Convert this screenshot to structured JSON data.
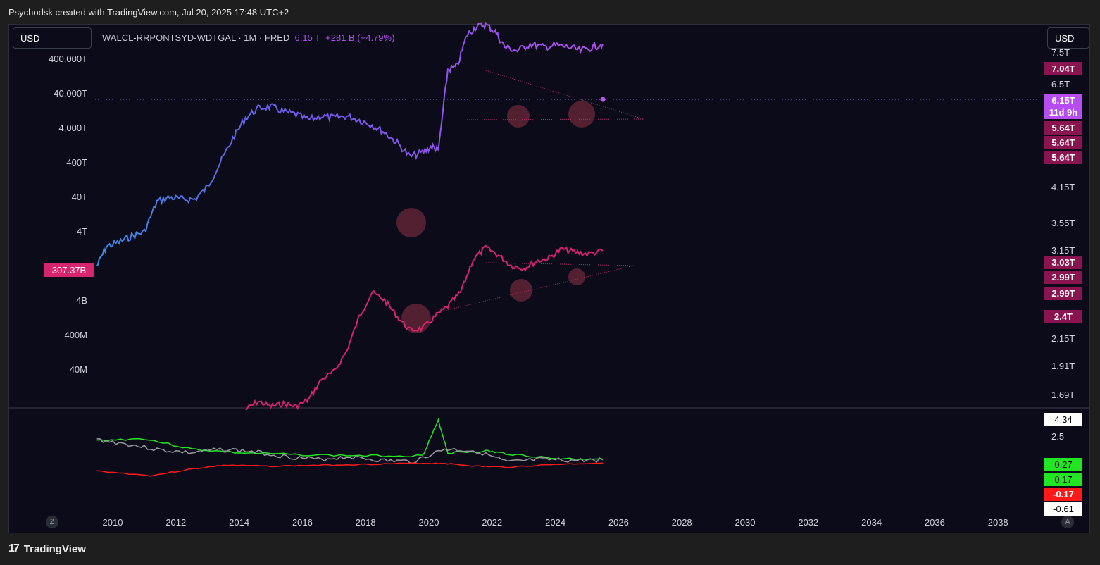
{
  "header": {
    "attribution": "Psychodsk created with TradingView.com, Jul 20, 2025 17:48 UTC+2"
  },
  "symbol": {
    "name": "WALCL-RRPONTSYD-WDTGAL · 1M · FRED",
    "value": "6.15 T",
    "change": "+281 B (+4.79%)"
  },
  "currency_left": "USD",
  "currency_right": "USD",
  "footer": {
    "brand": "TradingView"
  },
  "scale_buttons": {
    "left": "Z",
    "right": "A"
  },
  "left_axis_labels": [
    "400,000T",
    "40,000T",
    "4,000T",
    "400T",
    "40T",
    "4T",
    "40B",
    "4B",
    "400M",
    "40M"
  ],
  "left_axis_badge": "307.37B",
  "right_axis_labels": [
    "7.5T",
    "6.5T",
    "4.15T",
    "3.55T",
    "3.15T",
    "2.15T",
    "1.91T",
    "1.69T",
    "2.5"
  ],
  "right_badges": [
    {
      "text": "7.04T",
      "color": "#8a1450",
      "fg": "#ffffff"
    },
    {
      "text": "6.15T\n11d 9h",
      "color": "#b54df0",
      "fg": "#ffffff"
    },
    {
      "text": "5.64T",
      "color": "#8a1450",
      "fg": "#ffffff"
    },
    {
      "text": "5.64T",
      "color": "#8a1450",
      "fg": "#ffffff"
    },
    {
      "text": "5.64T",
      "color": "#8a1450",
      "fg": "#ffffff"
    },
    {
      "text": "3.03T",
      "color": "#8a1450",
      "fg": "#ffffff"
    },
    {
      "text": "2.99T",
      "color": "#8a1450",
      "fg": "#ffffff"
    },
    {
      "text": "2.99T",
      "color": "#8a1450",
      "fg": "#ffffff"
    },
    {
      "text": "2.4T",
      "color": "#8a1450",
      "fg": "#ffffff"
    },
    {
      "text": "4.34",
      "color": "#ffffff",
      "fg": "#000000"
    },
    {
      "text": "0.27",
      "color": "#22e622",
      "fg": "#000000"
    },
    {
      "text": "0.17",
      "color": "#22e622",
      "fg": "#000000"
    },
    {
      "text": "-0.17",
      "color": "#ff1a1a",
      "fg": "#ffffff"
    },
    {
      "text": "-0.61",
      "color": "#ffffff",
      "fg": "#000000"
    }
  ],
  "x_axis_labels": [
    "2010",
    "2012",
    "2014",
    "2016",
    "2018",
    "2020",
    "2022",
    "2024",
    "2026",
    "2028",
    "2030",
    "2032",
    "2034",
    "2036",
    "2038"
  ],
  "colors": {
    "main_line_start": "#3a8ee6",
    "main_line_end": "#b54df0",
    "pink_line": "#d6246e",
    "green": "#22e622",
    "gray": "#9a9aa0",
    "red": "#ff1a1a",
    "highlight": "#6b2838"
  },
  "chart_data": [
    {
      "type": "line",
      "title": "WALCL-RRPONTSYD-WDTGAL · 1M · FRED",
      "scale": "log",
      "series": [
        {
          "values_note": "",
          "x": [
            2009.5,
            2009.8,
            2010.2,
            2010.6,
            2011.0,
            2011.4,
            2011.8,
            2012.2,
            2012.6,
            2013.0,
            2013.4,
            2013.8,
            2014.2,
            2014.6,
            2015.0,
            2015.4,
            2015.8,
            2016.2,
            2016.6,
            2017.0,
            2017.4,
            2017.8,
            2018.2,
            2018.6,
            2019.0,
            2019.4,
            2019.8,
            2020.1,
            2020.3,
            2020.6,
            2020.9,
            2021.2,
            2021.5,
            2021.8,
            2022.1,
            2022.4,
            2022.8,
            2023.2,
            2023.6,
            2024.0,
            2024.4,
            2024.8,
            2025.2,
            2025.5
          ],
          "y": [
            0.4,
            1.5,
            2,
            3,
            4,
            30,
            40,
            35,
            35,
            80,
            400,
            2000,
            8000,
            15000,
            17000,
            12000,
            10000,
            7000,
            9000,
            8000,
            9000,
            7000,
            5000,
            3000,
            1500,
            600,
            800,
            1200,
            900,
            200000,
            250000,
            2000000,
            3500000,
            4000000,
            2500000,
            900000,
            700000,
            1100000,
            900000,
            1000000,
            900000,
            700000,
            900000,
            1100000
          ]
        },
        {
          "x": [
            2014.2,
            2014.6,
            2015.0,
            2015.4,
            2015.8,
            2016.2,
            2016.6,
            2017.0,
            2017.4,
            2017.8,
            2018.2,
            2018.6,
            2019.0,
            2019.4,
            2019.8,
            2020.2,
            2020.6,
            2021.0,
            2021.4,
            2021.8,
            2022.2,
            2022.6,
            2023.0,
            2023.4,
            2023.8,
            2024.2,
            2024.6,
            2025.0,
            2025.5
          ],
          "y": [
            0.04,
            0.07,
            0.05,
            0.06,
            0.05,
            0.08,
            0.3,
            0.5,
            2,
            20,
            100,
            60,
            20,
            8,
            9,
            20,
            40,
            100,
            900,
            2000,
            1200,
            600,
            500,
            800,
            1000,
            1800,
            1500,
            1300,
            1600
          ]
        }
      ]
    },
    {
      "type": "line",
      "title": "",
      "series": [
        {
          "x": [
            2009.5,
            2011.0,
            2012.5,
            2014.0,
            2016.0,
            2018.0,
            2019.8,
            2020.3,
            2020.6,
            2021.8,
            2022.5,
            2024.0,
            2025.5
          ],
          "y": [
            2.2,
            2.4,
            1.3,
            0.9,
            0.7,
            0.6,
            0.6,
            4.3,
            0.9,
            1.1,
            0.8,
            0.3,
            0.27
          ]
        },
        {
          "x": [
            2009.5,
            2010.5,
            2011.5,
            2012.5,
            2013.5,
            2014.5,
            2015.5,
            2016.5,
            2017.5,
            2018.5,
            2019.5,
            2020.5,
            2021.5,
            2022.5,
            2023.5,
            2024.5,
            2025.5
          ],
          "y": [
            2.3,
            1.8,
            1.2,
            0.9,
            1.3,
            1.0,
            0.5,
            0.2,
            0.5,
            0.1,
            0.0,
            1.3,
            1.1,
            -0.1,
            0.2,
            0.1,
            0.17
          ]
        },
        {
          "x": [
            2009.5,
            2011.2,
            2012.5,
            2013.5,
            2015.0,
            2016.5,
            2018.0,
            2019.5,
            2020.5,
            2021.5,
            2022.5,
            2024.0,
            2025.5
          ],
          "y": [
            -1.0,
            -1.5,
            -0.8,
            -0.4,
            -0.5,
            -0.4,
            -0.3,
            -0.2,
            -0.2,
            -0.5,
            -0.6,
            -0.3,
            -0.17
          ]
        }
      ]
    }
  ]
}
